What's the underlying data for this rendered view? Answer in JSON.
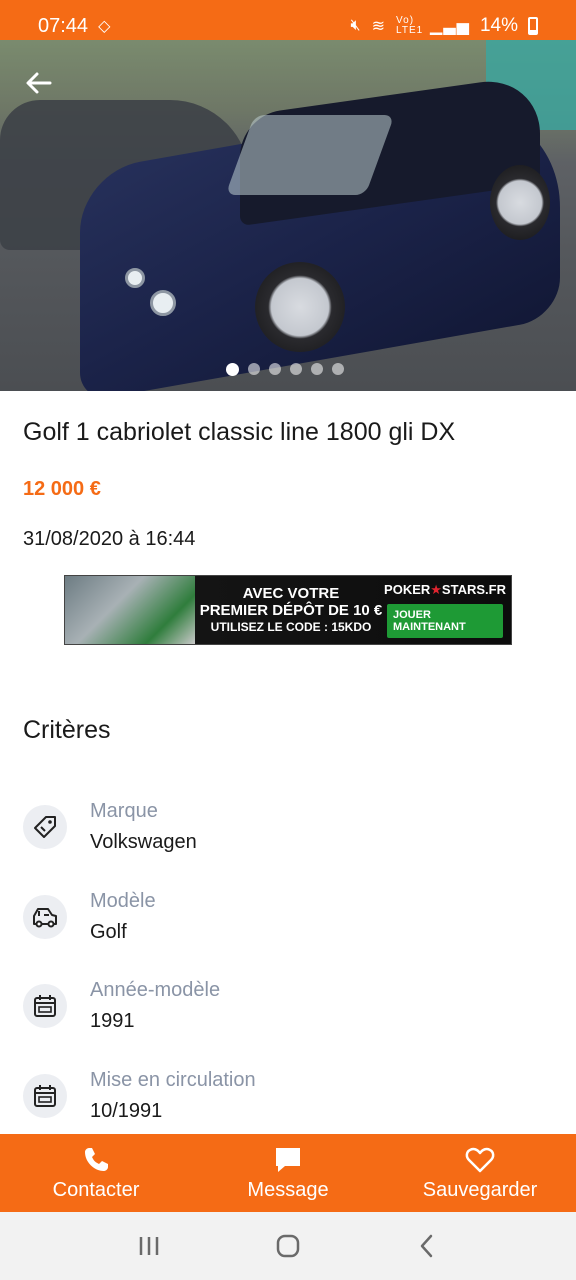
{
  "status_bar": {
    "time": "07:44",
    "battery": "14%",
    "network_label": "Vo) LTE1"
  },
  "gallery": {
    "total_images": 6,
    "active_index": 0
  },
  "listing": {
    "title": "Golf 1 cabriolet classic line 1800 gli DX",
    "price": "12 000 €",
    "date": "31/08/2020 à 16:44"
  },
  "ad_banner": {
    "line1": "AVEC VOTRE",
    "line2": "PREMIER DÉPÔT DE 10 €",
    "line3": "UTILISEZ LE CODE : 15KDO",
    "brand": "POKER",
    "brand_suffix": "STARS.FR",
    "cta": "JOUER MAINTENANT"
  },
  "criteria": {
    "title": "Critères",
    "items": [
      {
        "label": "Marque",
        "value": "Volkswagen",
        "icon": "tag-icon"
      },
      {
        "label": "Modèle",
        "value": "Golf",
        "icon": "car-icon"
      },
      {
        "label": "Année-modèle",
        "value": "1991",
        "icon": "calendar-icon"
      },
      {
        "label": "Mise en circulation",
        "value": "10/1991",
        "icon": "calendar-icon"
      }
    ]
  },
  "actions": {
    "contact": "Contacter",
    "message": "Message",
    "save": "Sauvegarder"
  },
  "colors": {
    "accent": "#f56b15",
    "label_gray": "#8a94a6"
  }
}
